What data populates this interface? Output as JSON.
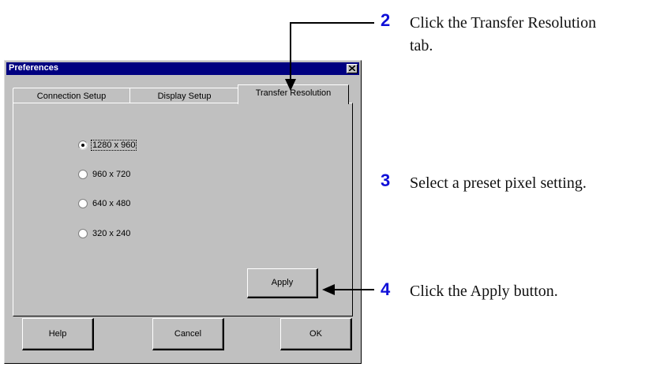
{
  "dialog": {
    "title": "Preferences",
    "tabs": [
      {
        "label": "Connection Setup",
        "selected": false
      },
      {
        "label": "Display Setup",
        "selected": false
      },
      {
        "label": "Transfer Resolution",
        "selected": true
      }
    ],
    "resolutions": [
      {
        "label": "1280 x 960",
        "selected": true
      },
      {
        "label": "960 x 720",
        "selected": false
      },
      {
        "label": "640 x 480",
        "selected": false
      },
      {
        "label": "320 x 240",
        "selected": false
      }
    ],
    "apply_label": "Apply",
    "help_label": "Help",
    "cancel_label": "Cancel",
    "ok_label": "OK"
  },
  "steps": [
    {
      "number": "2",
      "line1": "Click the Transfer Resolution",
      "line2": "tab."
    },
    {
      "number": "3",
      "line1": "Select a preset pixel setting."
    },
    {
      "number": "4",
      "line1": "Click the Apply button."
    }
  ],
  "colors": {
    "titlebar": "#000080",
    "dialog_face": "#c0c0c0",
    "step_number": "#1010d8"
  }
}
